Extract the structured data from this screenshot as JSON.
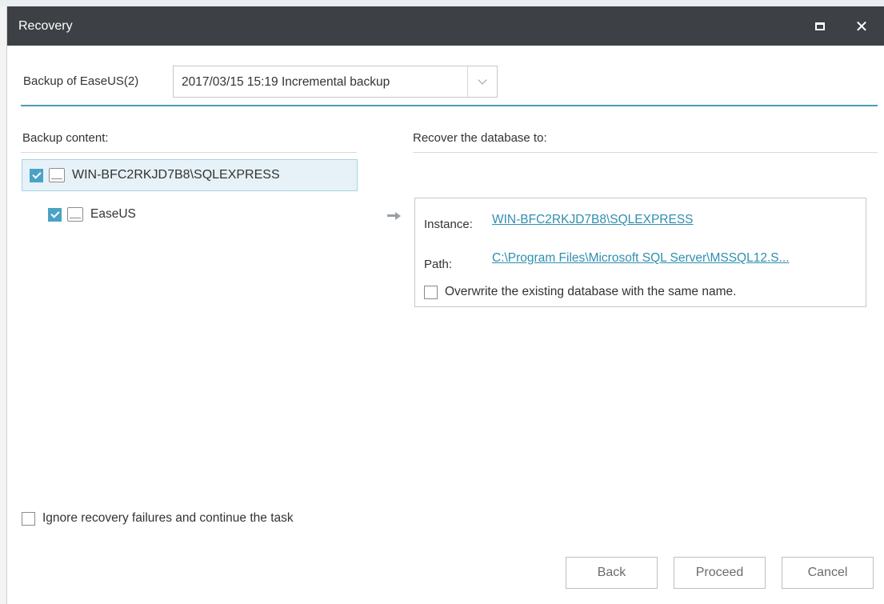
{
  "window": {
    "title": "Recovery"
  },
  "backup": {
    "label": "Backup of EaseUS(2)",
    "selected_version": "2017/03/15 15:19 Incremental backup"
  },
  "content": {
    "heading": "Backup content:",
    "items": [
      {
        "label": "WIN-BFC2RKJD7B8\\SQLEXPRESS",
        "checked": true,
        "icon": "drive-icon",
        "selected": true
      },
      {
        "label": "EaseUS",
        "checked": true,
        "icon": "drive-icon",
        "selected": false
      }
    ]
  },
  "target": {
    "heading": "Recover the database to:",
    "instance_label": "Instance:",
    "instance_value": "WIN-BFC2RKJD7B8\\SQLEXPRESS",
    "path_label": "Path:",
    "path_value": "C:\\Program Files\\Microsoft SQL Server\\MSSQL12.S...",
    "overwrite_label": "Overwrite the existing database with the same name.",
    "overwrite_checked": false
  },
  "options": {
    "ignore_failures_label": "Ignore recovery failures and continue the task",
    "ignore_failures_checked": false
  },
  "footer": {
    "back_label": "Back",
    "proceed_label": "Proceed",
    "cancel_label": "Cancel"
  },
  "colors": {
    "titlebar": "#3d4145",
    "accent": "#4aa3c6",
    "link": "#2f8fb0",
    "rule": "#4a9fb2"
  }
}
